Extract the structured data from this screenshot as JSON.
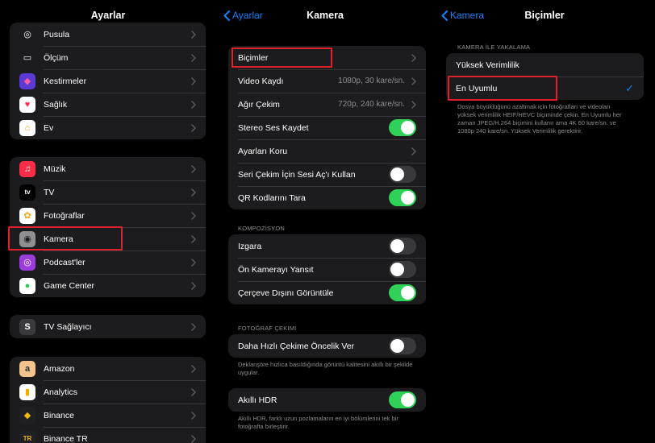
{
  "left": {
    "title": "Ayarlar",
    "group1": [
      {
        "label": "Pusula",
        "icon": "compass-icon",
        "glyph": "◎",
        "bg": "#1c1c1e",
        "fg": "#ffffff"
      },
      {
        "label": "Ölçüm",
        "icon": "ruler-icon",
        "glyph": "▭",
        "bg": "#1c1c1e",
        "fg": "#ffffff"
      },
      {
        "label": "Kestirmeler",
        "icon": "shortcuts-icon",
        "glyph": "◆",
        "bg": "#5b3bd6",
        "fg": "#ff5fa2"
      },
      {
        "label": "Sağlık",
        "icon": "health-icon",
        "glyph": "♥",
        "bg": "#ffffff",
        "fg": "#ff2d55"
      },
      {
        "label": "Ev",
        "icon": "home-icon",
        "glyph": "⌂",
        "bg": "#ffffff",
        "fg": "#ff9500"
      }
    ],
    "group2": [
      {
        "label": "Müzik",
        "icon": "music-icon",
        "glyph": "♫",
        "bg": "#fa2d48",
        "fg": "#ffffff"
      },
      {
        "label": "TV",
        "icon": "appletv-icon",
        "glyph": "tv",
        "bg": "#000000",
        "fg": "#ffffff"
      },
      {
        "label": "Fotoğraflar",
        "icon": "photos-icon",
        "glyph": "✿",
        "bg": "#ffffff",
        "fg": "#ff9f0a"
      },
      {
        "label": "Kamera",
        "icon": "camera-icon",
        "glyph": "◉",
        "bg": "#8e8e93",
        "fg": "#1c1c1e"
      },
      {
        "label": "Podcast'ler",
        "icon": "podcasts-icon",
        "glyph": "◎",
        "bg": "#9b3ddb",
        "fg": "#ffffff"
      },
      {
        "label": "Game Center",
        "icon": "game-center-icon",
        "glyph": "●",
        "bg": "#ffffff",
        "fg": "#34c759"
      }
    ],
    "group3": [
      {
        "label": "TV Sağlayıcı",
        "icon": "tv-provider-icon",
        "glyph": "S",
        "bg": "#3a3a3c",
        "fg": "#ffffff"
      }
    ],
    "group4": [
      {
        "label": "Amazon",
        "icon": "amazon-icon",
        "glyph": "a",
        "bg": "#f2c48c",
        "fg": "#232f3e"
      },
      {
        "label": "Analytics",
        "icon": "analytics-icon",
        "glyph": "▮",
        "bg": "#ffffff",
        "fg": "#f9ab00"
      },
      {
        "label": "Binance",
        "icon": "binance-icon",
        "glyph": "◆",
        "bg": "#1e2026",
        "fg": "#f0b90b"
      },
      {
        "label": "Binance TR",
        "icon": "binance-tr-icon",
        "glyph": "TR",
        "bg": "#1e2026",
        "fg": "#f0b90b"
      }
    ]
  },
  "middle": {
    "back": "Ayarlar",
    "title": "Kamera",
    "group1": [
      {
        "label": "Biçimler",
        "value": "",
        "control": "chevron"
      },
      {
        "label": "Video Kaydı",
        "value": "1080p, 30 kare/sn.",
        "control": "chevron"
      },
      {
        "label": "Ağır Çekim",
        "value": "720p, 240 kare/sn.",
        "control": "chevron"
      },
      {
        "label": "Stereo Ses Kaydet",
        "value": "",
        "control": "on"
      },
      {
        "label": "Ayarları Koru",
        "value": "",
        "control": "chevron"
      },
      {
        "label": "Seri Çekim İçin Sesi Aç'ı Kullan",
        "value": "",
        "control": "off"
      },
      {
        "label": "QR Kodlarını Tara",
        "value": "",
        "control": "on"
      }
    ],
    "section_composition": "KOMPOZİSYON",
    "group2": [
      {
        "label": "Izgara",
        "control": "off"
      },
      {
        "label": "Ön Kamerayı Yansıt",
        "control": "off"
      },
      {
        "label": "Çerçeve Dışını Görüntüle",
        "control": "on"
      }
    ],
    "section_photo": "FOTOĞRAF ÇEKİMİ",
    "group3": [
      {
        "label": "Daha Hızlı Çekime Öncelik Ver",
        "control": "off"
      }
    ],
    "footnote1": "Deklanşöre hızlıca basıldığında görüntü kalitesini akıllı bir şekilde uygular.",
    "group4": [
      {
        "label": "Akıllı HDR",
        "control": "on"
      }
    ],
    "footnote2": "Akıllı HDR, farklı uzun pozlamaların en iyi bölümlerini tek bir fotoğrafta birleştirir."
  },
  "right": {
    "back": "Kamera",
    "title": "Biçimler",
    "section": "KAMERA İLE YAKALAMA",
    "options": [
      {
        "label": "Yüksek Verimlilik",
        "selected": false
      },
      {
        "label": "En Uyumlu",
        "selected": true
      }
    ],
    "footnote": "Dosya büyüklüğünü azaltmak için fotoğrafları ve videoları yüksek verimlilik HEIF/HEVC biçiminde çekin. En Uyumlu her zaman JPEG/H.264 biçimini kullanır ama 4K 60 kare/sn. ve 1080p 240 kare/sn. Yüksek Verimlilik gerektirir."
  },
  "colors": {
    "accent": "#0a84ff",
    "toggle_on": "#30d158",
    "highlight": "#e0202a"
  }
}
